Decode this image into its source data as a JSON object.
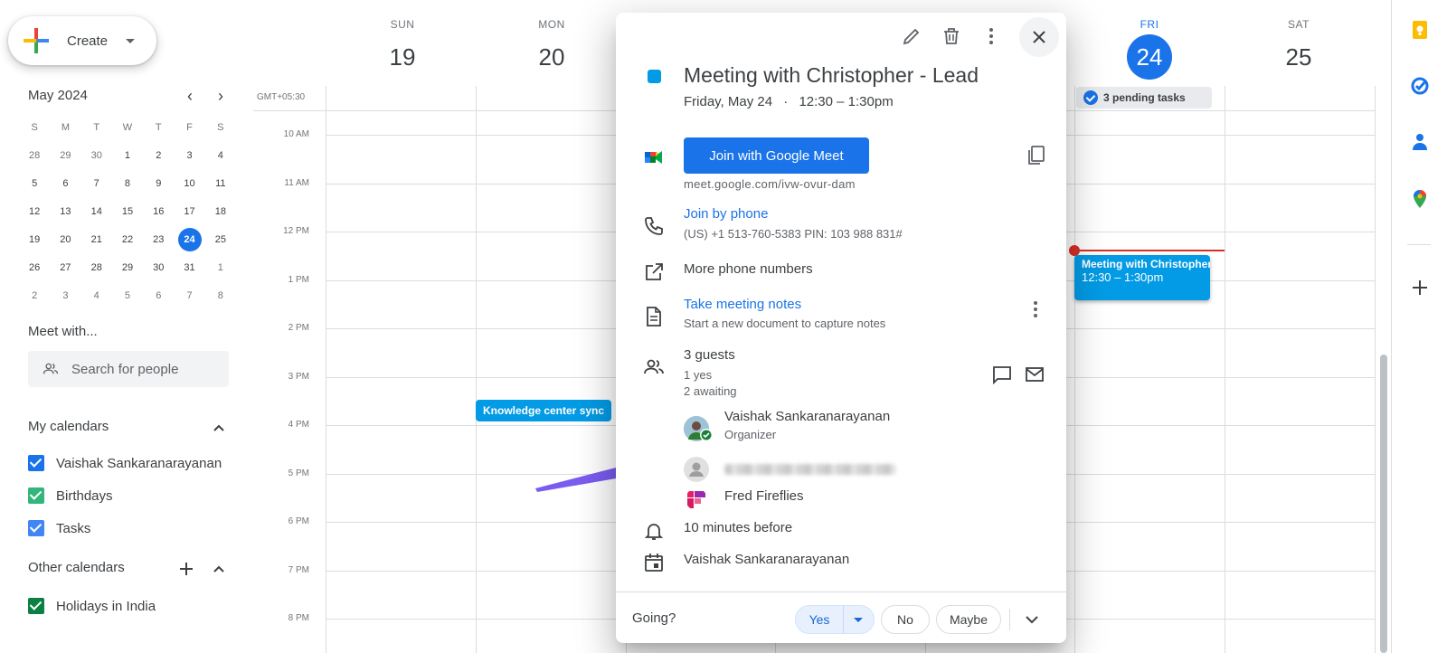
{
  "sidebar": {
    "create_label": "Create",
    "mini_month_title": "May 2024",
    "dow": [
      "S",
      "M",
      "T",
      "W",
      "T",
      "F",
      "S"
    ],
    "weeks": [
      [
        {
          "d": "28",
          "o": true
        },
        {
          "d": "29",
          "o": true
        },
        {
          "d": "30",
          "o": true
        },
        {
          "d": "1"
        },
        {
          "d": "2"
        },
        {
          "d": "3"
        },
        {
          "d": "4"
        }
      ],
      [
        {
          "d": "5"
        },
        {
          "d": "6"
        },
        {
          "d": "7"
        },
        {
          "d": "8"
        },
        {
          "d": "9"
        },
        {
          "d": "10"
        },
        {
          "d": "11"
        }
      ],
      [
        {
          "d": "12"
        },
        {
          "d": "13"
        },
        {
          "d": "14"
        },
        {
          "d": "15"
        },
        {
          "d": "16"
        },
        {
          "d": "17"
        },
        {
          "d": "18"
        }
      ],
      [
        {
          "d": "19"
        },
        {
          "d": "20"
        },
        {
          "d": "21"
        },
        {
          "d": "22"
        },
        {
          "d": "23"
        },
        {
          "d": "24",
          "today": true
        },
        {
          "d": "25"
        }
      ],
      [
        {
          "d": "26"
        },
        {
          "d": "27"
        },
        {
          "d": "28"
        },
        {
          "d": "29"
        },
        {
          "d": "30"
        },
        {
          "d": "31"
        },
        {
          "d": "1",
          "o": true
        }
      ],
      [
        {
          "d": "2",
          "o": true
        },
        {
          "d": "3",
          "o": true
        },
        {
          "d": "4",
          "o": true
        },
        {
          "d": "5",
          "o": true
        },
        {
          "d": "6",
          "o": true
        },
        {
          "d": "7",
          "o": true
        },
        {
          "d": "8",
          "o": true
        }
      ]
    ],
    "meet_with": "Meet with...",
    "search_placeholder": "Search for people",
    "my_calendars_title": "My calendars",
    "my_calendars": [
      {
        "name": "Vaishak Sankaranarayanan",
        "color": "#1a73e8"
      },
      {
        "name": "Birthdays",
        "color": "#33b679"
      },
      {
        "name": "Tasks",
        "color": "#4285f4"
      }
    ],
    "other_calendars_title": "Other calendars",
    "other_calendars": [
      {
        "name": "Holidays in India",
        "color": "#0b8043"
      }
    ]
  },
  "week": {
    "days": [
      {
        "dow": "SUN",
        "num": "19"
      },
      {
        "dow": "MON",
        "num": "20"
      },
      {
        "dow": "FRI",
        "num": "24",
        "today": true
      },
      {
        "dow": "SAT",
        "num": "25"
      }
    ],
    "timezone": "GMT+05:30",
    "hours": [
      "10 AM",
      "11 AM",
      "12 PM",
      "1 PM",
      "2 PM",
      "3 PM",
      "4 PM",
      "5 PM",
      "6 PM",
      "7 PM",
      "8 PM"
    ],
    "pending_tasks": "3 pending tasks",
    "events": {
      "knowledge": {
        "title": "Knowledge center sync"
      },
      "meeting": {
        "title": "Meeting with Christopher",
        "time": "12:30 – 1:30pm"
      }
    }
  },
  "popup": {
    "title": "Meeting with Christopher - Lead",
    "when_date": "Friday, May 24",
    "when_sep": "·",
    "when_time": "12:30 – 1:30pm",
    "join_meet": "Join with Google Meet",
    "meet_link": "meet.google.com/ivw-ovur-dam",
    "join_phone": "Join by phone",
    "phone_detail": "(US) +1 513-760-5383 PIN: 103 988 831#",
    "more_phone": "More phone numbers",
    "take_notes": "Take meeting notes",
    "notes_sub": "Start a new document to capture notes",
    "guests_count": "3 guests",
    "guests_yes": "1 yes",
    "guests_awaiting": "2 awaiting",
    "guests": [
      {
        "name": "Vaishak Sankaranarayanan",
        "role": "Organizer"
      },
      {
        "name": "",
        "role": ""
      },
      {
        "name": "Fred Fireflies",
        "role": ""
      }
    ],
    "reminder": "10 minutes before",
    "calendar_owner": "Vaishak Sankaranarayanan",
    "going_label": "Going?",
    "rsvp": {
      "yes": "Yes",
      "no": "No",
      "maybe": "Maybe"
    }
  },
  "colors": {
    "accent": "#1a73e8",
    "event": "#039be5",
    "now": "#d93025"
  }
}
